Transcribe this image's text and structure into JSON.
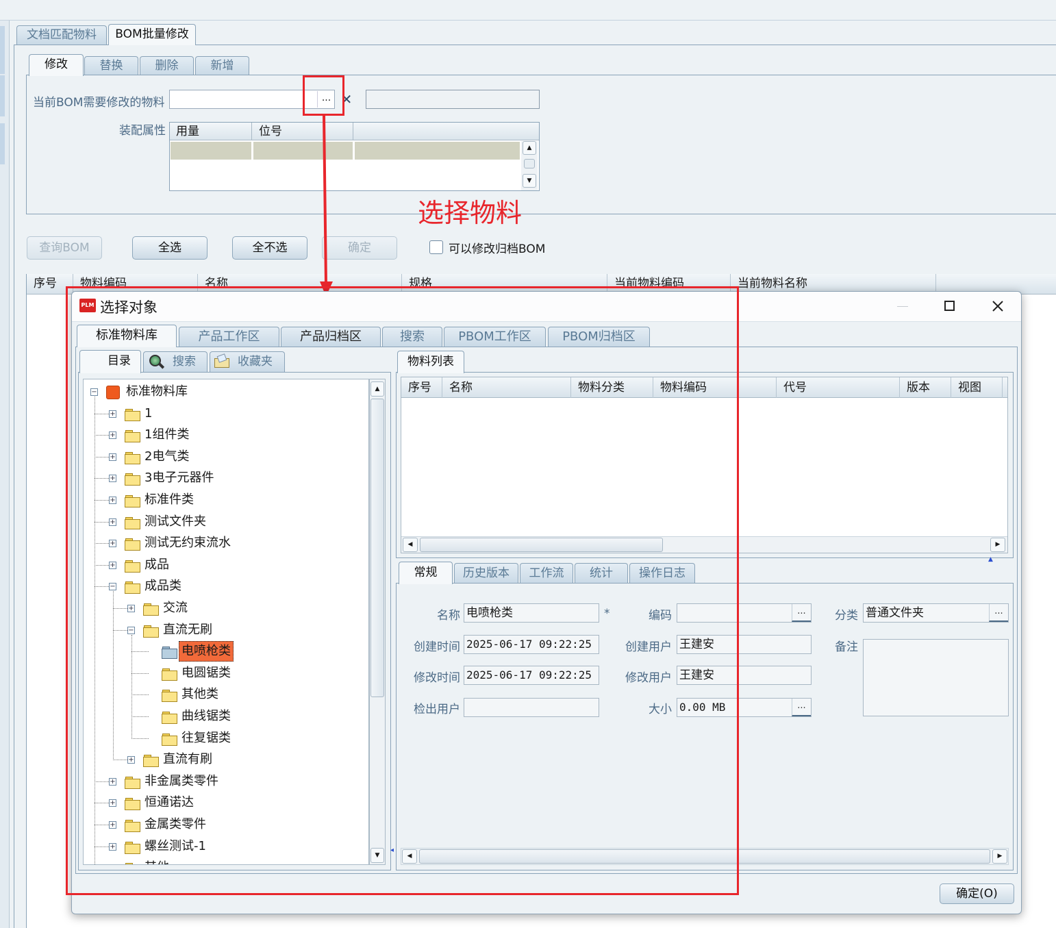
{
  "outer_tabs": [
    "文档匹配物料",
    "BOM批量修改"
  ],
  "inner_tabs": [
    "修改",
    "替换",
    "删除",
    "新增"
  ],
  "form": {
    "material_label": "当前BOM需要修改的物料",
    "material_value": "",
    "ellipsis": "...",
    "clear_symbol": "✕",
    "assembly_label": "装配属性",
    "assembly_columns": [
      "用量",
      "位号"
    ]
  },
  "annotation": {
    "text": "选择物料",
    "color": "#e8262c"
  },
  "actions": {
    "query": "查询BOM",
    "select_all": "全选",
    "select_none": "全不选",
    "confirm": "确定",
    "archived_checkbox": "可以修改归档BOM"
  },
  "result_columns": [
    "序号",
    "物料编码",
    "名称",
    "规格",
    "当前物料编码",
    "当前物料名称"
  ],
  "dialog": {
    "logo": "PLM",
    "title": "选择对象",
    "tabs": [
      "标准物料库",
      "产品工作区",
      "产品归档区",
      "搜索",
      "PBOM工作区",
      "PBOM归档区"
    ],
    "left_tabs": [
      "目录",
      "搜索",
      "收藏夹"
    ],
    "tree": [
      {
        "label": "标准物料库",
        "level": 0,
        "state": "expanded",
        "kind": "root"
      },
      {
        "label": "1",
        "level": 1,
        "state": "collapsed"
      },
      {
        "label": "1组件类",
        "level": 1,
        "state": "collapsed"
      },
      {
        "label": "2电气类",
        "level": 1,
        "state": "collapsed"
      },
      {
        "label": "3电子元器件",
        "level": 1,
        "state": "collapsed"
      },
      {
        "label": "标准件类",
        "level": 1,
        "state": "collapsed"
      },
      {
        "label": "测试文件夹",
        "level": 1,
        "state": "collapsed"
      },
      {
        "label": "测试无约束流水",
        "level": 1,
        "state": "collapsed"
      },
      {
        "label": "成品",
        "level": 1,
        "state": "collapsed"
      },
      {
        "label": "成品类",
        "level": 1,
        "state": "expanded"
      },
      {
        "label": "交流",
        "level": 2,
        "state": "collapsed"
      },
      {
        "label": "直流无刷",
        "level": 2,
        "state": "expanded"
      },
      {
        "label": "电喷枪类",
        "level": 3,
        "state": "leaf",
        "selected": true
      },
      {
        "label": "电圆锯类",
        "level": 3,
        "state": "leaf"
      },
      {
        "label": "其他类",
        "level": 3,
        "state": "leaf"
      },
      {
        "label": "曲线锯类",
        "level": 3,
        "state": "leaf"
      },
      {
        "label": "往复锯类",
        "level": 3,
        "state": "leaf"
      },
      {
        "label": "直流有刷",
        "level": 2,
        "state": "collapsed"
      },
      {
        "label": "非金属类零件",
        "level": 1,
        "state": "collapsed"
      },
      {
        "label": "恒通诺达",
        "level": 1,
        "state": "collapsed"
      },
      {
        "label": "金属类零件",
        "level": 1,
        "state": "collapsed"
      },
      {
        "label": "螺丝测试-1",
        "level": 1,
        "state": "collapsed"
      },
      {
        "label": "其他",
        "level": 1,
        "state": "collapsed"
      }
    ],
    "list_tab": "物料列表",
    "list_columns": [
      "序号",
      "名称",
      "物料分类",
      "物料编码",
      "代号",
      "版本",
      "视图"
    ],
    "detail_tabs": [
      "常规",
      "历史版本",
      "工作流",
      "统计",
      "操作日志"
    ],
    "detail": {
      "name_label": "名称",
      "name_value": "电喷枪类",
      "required_mark": "*",
      "code_label": "编码",
      "code_value": "",
      "category_label": "分类",
      "category_value": "普通文件夹",
      "created_time_label": "创建时间",
      "created_time_value": "2025-06-17 09:22:25",
      "created_user_label": "创建用户",
      "created_user_value": "王建安",
      "modified_time_label": "修改时间",
      "modified_time_value": "2025-06-17 09:22:25",
      "modified_user_label": "修改用户",
      "modified_user_value": "王建安",
      "checkout_user_label": "检出用户",
      "checkout_user_value": "",
      "size_label": "大小",
      "size_value": "0.00 MB",
      "remark_label": "备注",
      "remark_value": ""
    },
    "ok_button": "确定(O)"
  }
}
